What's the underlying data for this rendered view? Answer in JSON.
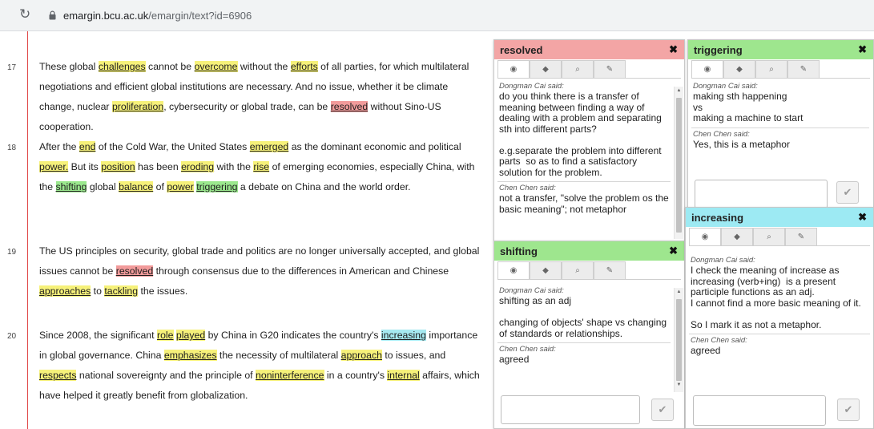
{
  "browser": {
    "url_host": "emargin.bcu.ac.uk",
    "url_path": "/emargin/text?id=6906"
  },
  "colors": {
    "highlight_yellow": "#f6f17a",
    "highlight_red": "#f29b9b",
    "highlight_green": "#9be88e",
    "highlight_cyan": "#a6e9f0",
    "margin_line": "#e04848"
  },
  "icons": [
    "reload-icon",
    "lock-icon",
    "comment-tab-icon",
    "tag-tab-icon",
    "search-tab-icon",
    "link-tab-icon",
    "close-icon",
    "check-icon"
  ],
  "paragraphs": [
    {
      "number": "17",
      "lines": [
        [
          {
            "t": "These global "
          },
          {
            "t": "challenges",
            "hl": "y"
          },
          {
            "t": " cannot be "
          },
          {
            "t": "overcome",
            "hl": "y"
          },
          {
            "t": " without the "
          },
          {
            "t": "efforts",
            "hl": "y"
          },
          {
            "t": " of all parties, for which multilateral"
          }
        ],
        [
          {
            "t": "negotiations and efficient global institutions are necessary. And no issue, whether it be climate"
          }
        ],
        [
          {
            "t": "change, nuclear "
          },
          {
            "t": "proliferation",
            "hl": "y"
          },
          {
            "t": ", cybersecurity or global trade, can be "
          },
          {
            "t": "resolved",
            "hl": "r"
          },
          {
            "t": " without Sino-US"
          }
        ],
        [
          {
            "t": "cooperation."
          }
        ]
      ]
    },
    {
      "number": "18",
      "lines": [
        [
          {
            "t": "After the "
          },
          {
            "t": "end",
            "hl": "y"
          },
          {
            "t": " of the Cold War, the United States "
          },
          {
            "t": "emerged",
            "hl": "y"
          },
          {
            "t": " as the dominant economic and political"
          }
        ],
        [
          {
            "t": "power.",
            "hl": "y"
          },
          {
            "t": " But its "
          },
          {
            "t": "position",
            "hl": "y"
          },
          {
            "t": " has been "
          },
          {
            "t": "eroding",
            "hl": "y"
          },
          {
            "t": " with the "
          },
          {
            "t": "rise",
            "hl": "y"
          },
          {
            "t": " of emerging economies, especially China, with"
          }
        ],
        [
          {
            "t": "the "
          },
          {
            "t": "shifting",
            "hl": "g"
          },
          {
            "t": " global "
          },
          {
            "t": "balance",
            "hl": "y"
          },
          {
            "t": " of "
          },
          {
            "t": "power",
            "hl": "y"
          },
          {
            "t": " "
          },
          {
            "t": "triggering",
            "hl": "g"
          },
          {
            "t": " a debate on China and the world order."
          }
        ]
      ]
    },
    {
      "number": "19",
      "lines": [
        [
          {
            "t": "The US principles on security, global trade and politics are no longer universally accepted, and global"
          }
        ],
        [
          {
            "t": "issues cannot be "
          },
          {
            "t": "resolved",
            "hl": "r"
          },
          {
            "t": " through consensus due to the differences in American and Chinese"
          }
        ],
        [
          {
            "t": "approaches",
            "hl": "y"
          },
          {
            "t": " to "
          },
          {
            "t": "tackling",
            "hl": "y"
          },
          {
            "t": " the issues."
          }
        ]
      ]
    },
    {
      "number": "20",
      "lines": [
        [
          {
            "t": "Since 2008, the significant "
          },
          {
            "t": "role",
            "hl": "y"
          },
          {
            "t": " "
          },
          {
            "t": "played",
            "hl": "y"
          },
          {
            "t": " by China in G20 indicates the country's "
          },
          {
            "t": "increasing",
            "hl": "c"
          },
          {
            "t": " importance"
          }
        ],
        [
          {
            "t": "in global governance. China "
          },
          {
            "t": "emphasizes",
            "hl": "y"
          },
          {
            "t": " the necessity of multilateral "
          },
          {
            "t": "approach",
            "hl": "y"
          },
          {
            "t": " to issues, and"
          }
        ],
        [
          {
            "t": "respects",
            "hl": "y"
          },
          {
            "t": " national sovereignty and the principle of "
          },
          {
            "t": "noninterference",
            "hl": "y"
          },
          {
            "t": " in a country's "
          },
          {
            "t": "internal",
            "hl": "y"
          },
          {
            "t": " affairs, which"
          }
        ],
        [
          {
            "t": "have helped it greatly benefit from globalization."
          }
        ]
      ]
    }
  ],
  "popups": {
    "resolved": {
      "title": "resolved",
      "close": "✖",
      "comments": [
        {
          "author": "Dongman Cai said:",
          "text": "do you think there is a transfer of meaning between finding a way of dealing with a problem and separating sth into different parts?\n\ne.g.separate the problem into different parts  so as to find a satisfactory solution for the problem."
        },
        {
          "author": "Chen Chen said:",
          "text": "not a transfer, \"solve the problem os the basic meaning\"; not metaphor"
        }
      ]
    },
    "triggering": {
      "title": "triggering",
      "close": "✖",
      "comments": [
        {
          "author": "Dongman Cai said:",
          "text": "making sth happening\nvs\nmaking a machine to start"
        },
        {
          "author": "Chen Chen said:",
          "text": "Yes, this is a metaphor"
        }
      ],
      "submit": "✔"
    },
    "shifting": {
      "title": "shifting",
      "close": "✖",
      "comments": [
        {
          "author": "Dongman Cai said:",
          "text": "shifting as an adj\n\nchanging of objects' shape vs changing of standards or relationships."
        },
        {
          "author": "Chen Chen said:",
          "text": "agreed"
        }
      ],
      "submit": "✔"
    },
    "increasing": {
      "title": "increasing",
      "close": "✖",
      "comments": [
        {
          "author": "Dongman Cai said:",
          "text": "I check the meaning of increase as increasing (verb+ing)  is a present participle functions as an adj.\nI cannot find a more basic meaning of it.\n\nSo I mark it as not a metaphor."
        },
        {
          "author": "Chen Chen said:",
          "text": "agreed"
        }
      ],
      "submit": "✔"
    }
  }
}
